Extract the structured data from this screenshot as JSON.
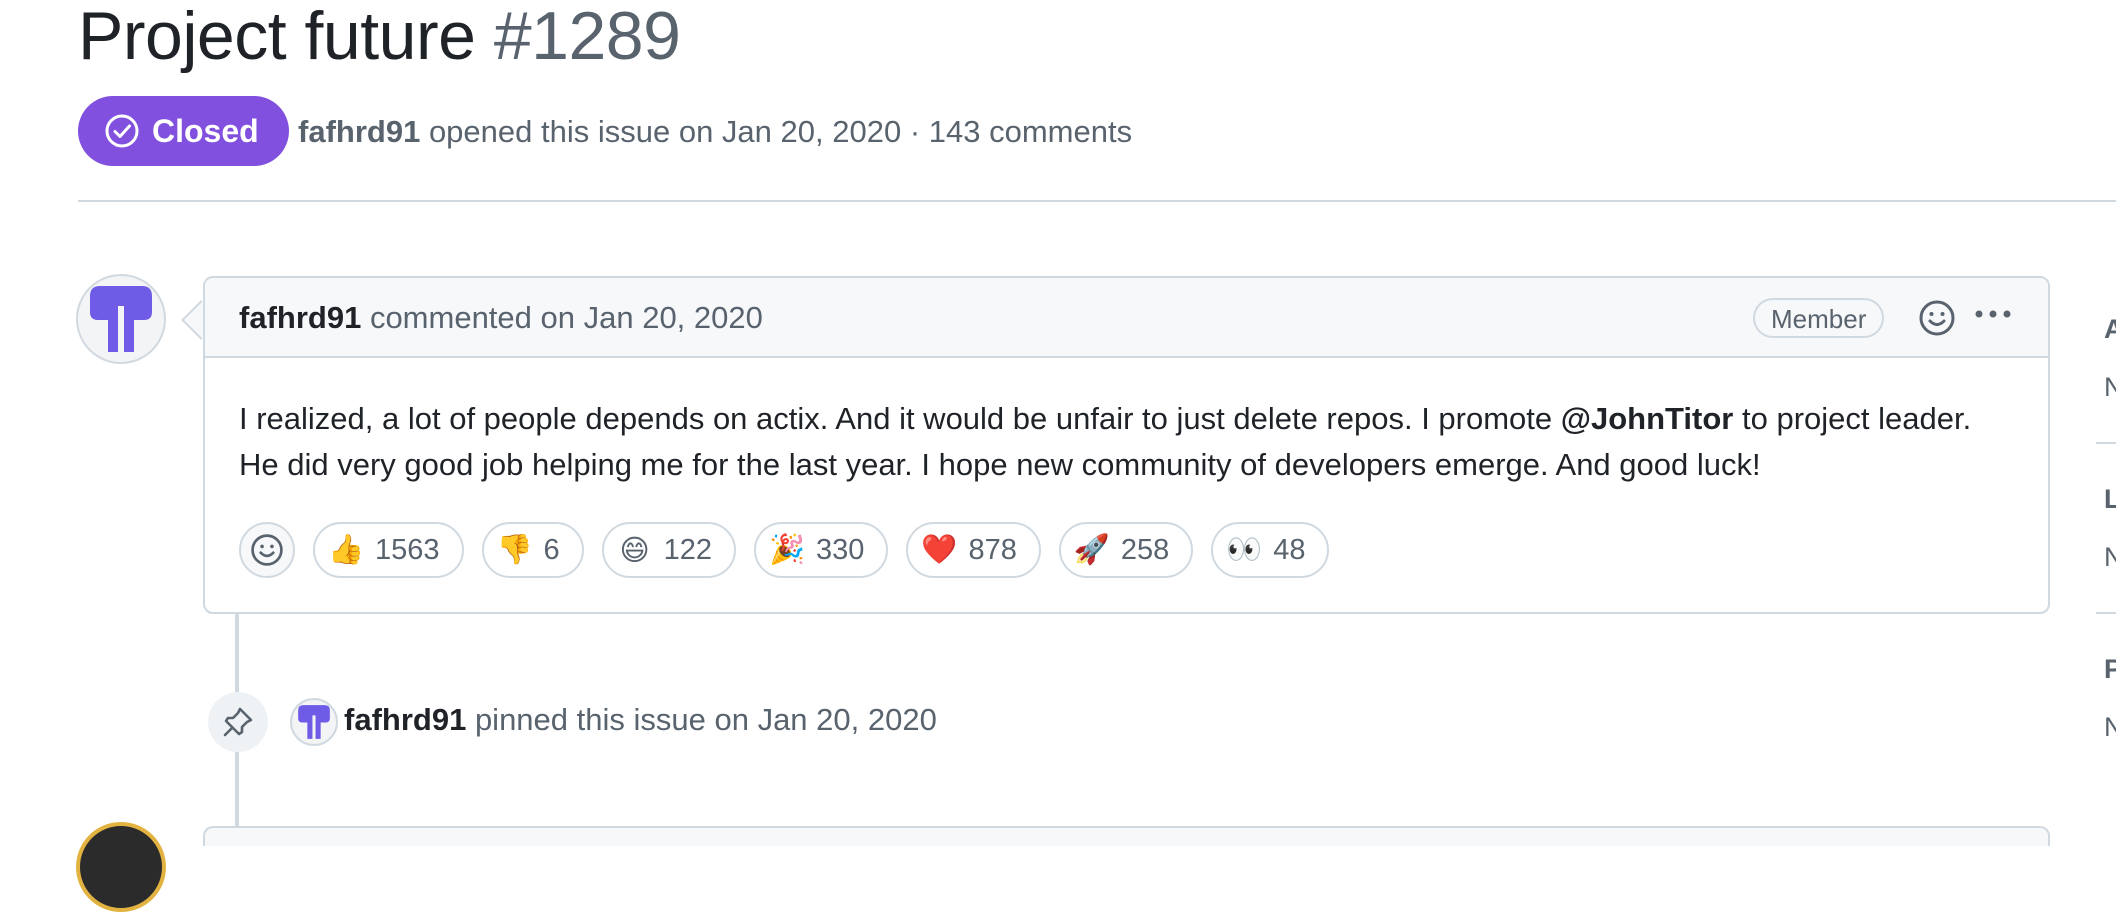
{
  "issue": {
    "title": "Project future",
    "number": "#1289",
    "state": "Closed",
    "author": "fafhrd91",
    "opened_text": "opened this issue on Jan 20, 2020",
    "separator": "·",
    "comments_count": "143 comments"
  },
  "comment": {
    "author": "fafhrd91",
    "action": "commented on Jan 20, 2020",
    "role_badge": "Member",
    "body_part1": "I realized, a lot of people depends on actix. And it would be unfair to just delete repos. I promote ",
    "mention": "@JohnTitor",
    "body_part2": " to project leader. He did very good job helping me for the last year. I hope new community of developers emerge. And good luck!",
    "reactions": [
      {
        "emoji": "👍",
        "count": "1563"
      },
      {
        "emoji": "👎",
        "count": "6"
      },
      {
        "emoji": "😄",
        "count": "122"
      },
      {
        "emoji": "🎉",
        "count": "330"
      },
      {
        "emoji": "❤️",
        "count": "878"
      },
      {
        "emoji": "🚀",
        "count": "258"
      },
      {
        "emoji": "👀",
        "count": "48"
      }
    ]
  },
  "pin_event": {
    "actor": "fafhrd91",
    "text": "pinned this issue on Jan 20, 2020"
  },
  "sidebar": {
    "items": [
      {
        "label": "A",
        "value": "N"
      },
      {
        "label": "L",
        "value": "N"
      },
      {
        "label": "P",
        "value": "N"
      }
    ]
  },
  "colors": {
    "closed_purple": "#8250df",
    "logo_purple": "#6e5ce6",
    "border": "#d1d9e0",
    "muted_text": "#59636e"
  },
  "icons": {
    "state": "check-circle-icon",
    "add_reaction": "smiley-icon",
    "more": "kebab-horizontal-icon",
    "pin": "pin-icon"
  }
}
